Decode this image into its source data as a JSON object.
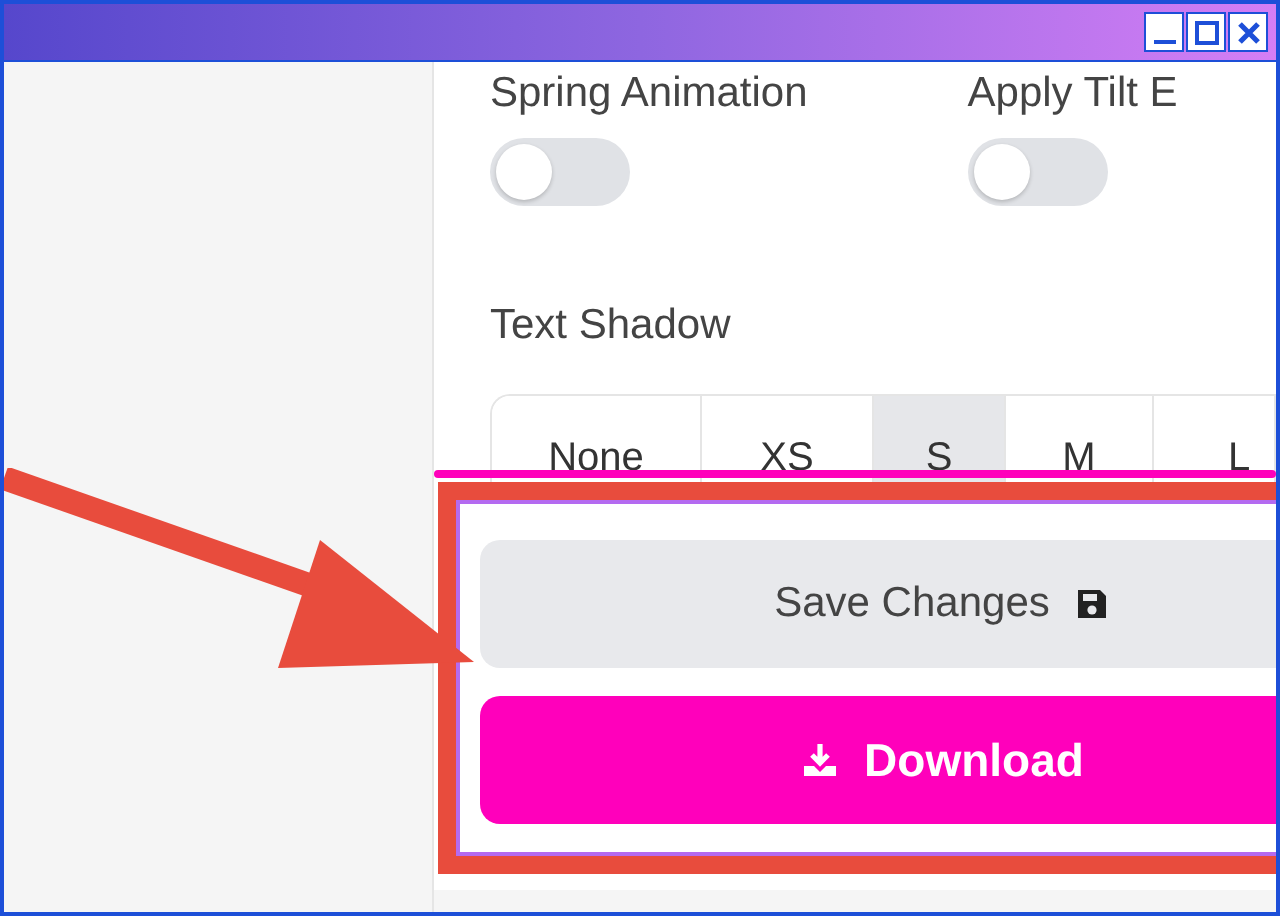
{
  "toggles": [
    {
      "label": "Spring Animation",
      "on": false
    },
    {
      "label": "Apply Tilt E",
      "on": false
    }
  ],
  "text_shadow": {
    "label": "Text Shadow",
    "options": [
      {
        "label": "None",
        "selected": false
      },
      {
        "label": "XS",
        "selected": false
      },
      {
        "label": "S",
        "selected": true
      },
      {
        "label": "M",
        "selected": false
      },
      {
        "label": "L",
        "selected": false
      }
    ]
  },
  "buttons": [
    {
      "kind": "secondary",
      "label": "Save Changes"
    },
    {
      "kind": "primary",
      "label": "Download"
    }
  ]
}
